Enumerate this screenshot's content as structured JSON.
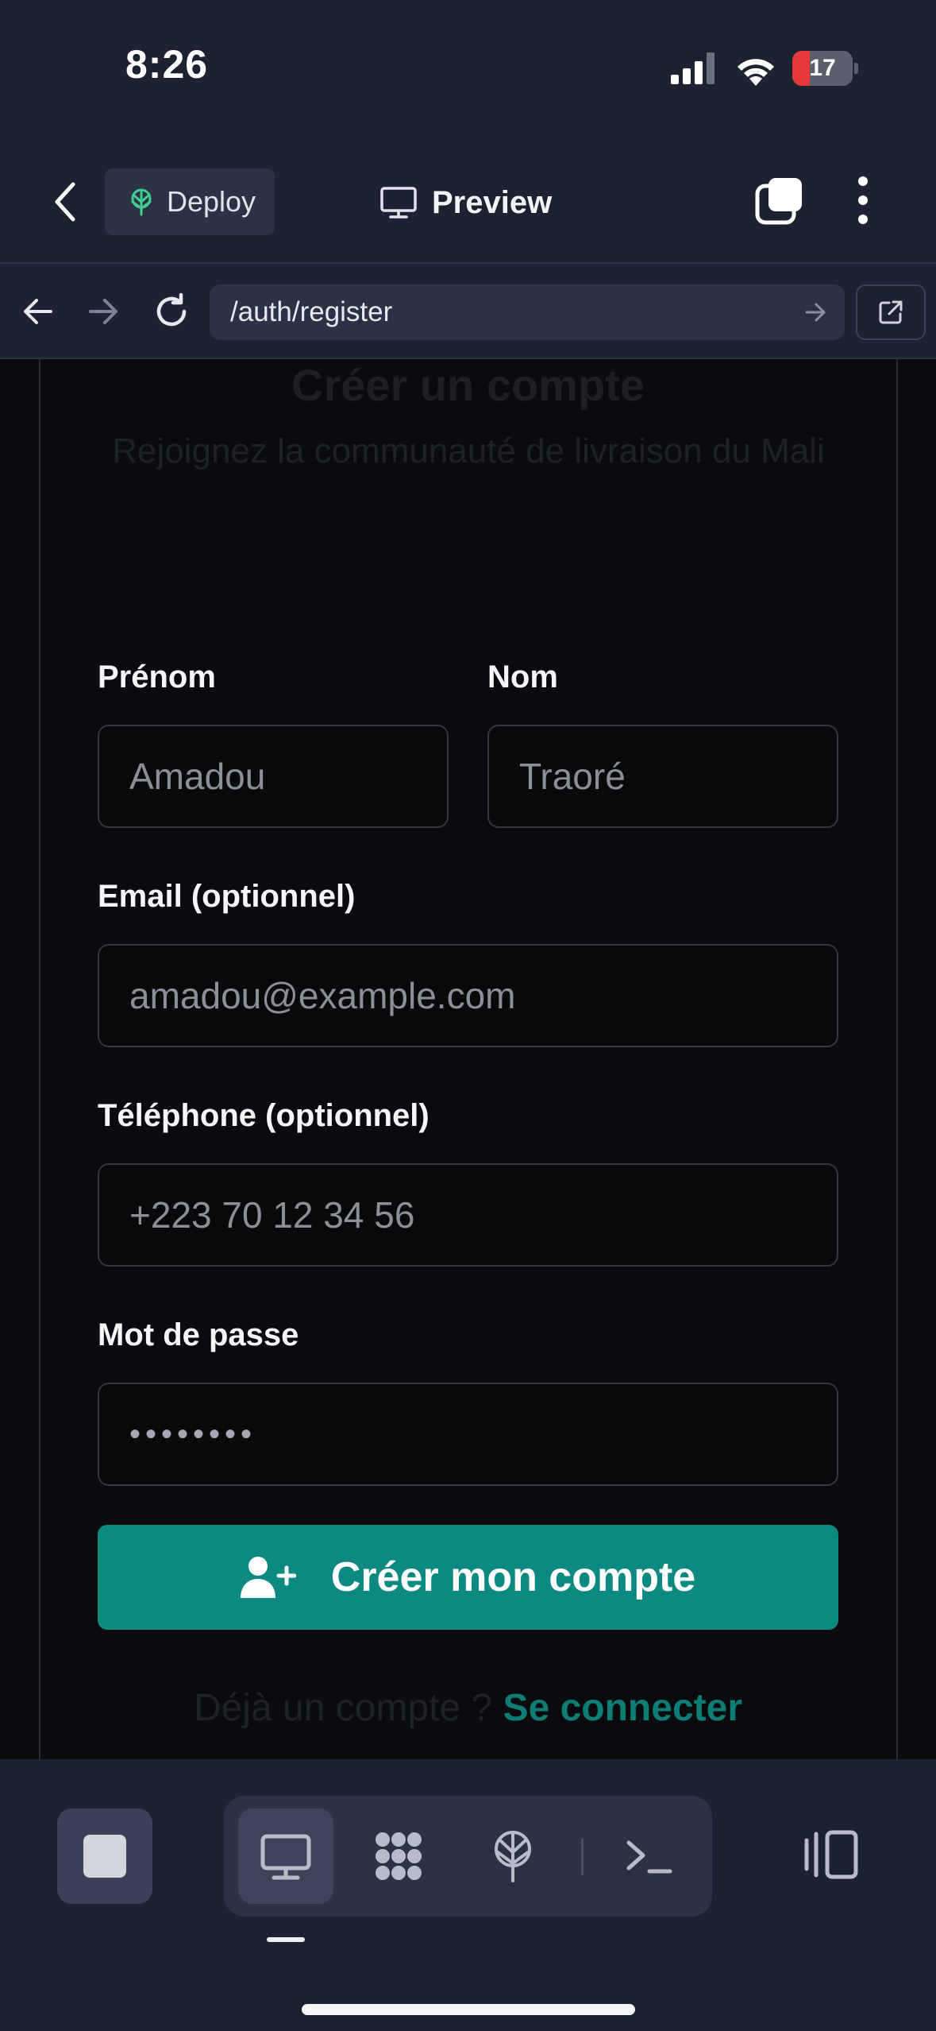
{
  "status_bar": {
    "time": "8:26",
    "battery": "17"
  },
  "toolbar": {
    "deploy_label": "Deploy",
    "preview_label": "Preview"
  },
  "urlbar": {
    "url": "/auth/register"
  },
  "page": {
    "title": "Créer un compte",
    "subtitle": "Rejoignez la communauté de livraison du Mali",
    "fields": {
      "first_name": {
        "label": "Prénom",
        "placeholder": "Amadou"
      },
      "last_name": {
        "label": "Nom",
        "placeholder": "Traoré"
      },
      "email": {
        "label": "Email (optionnel)",
        "placeholder": "amadou@example.com"
      },
      "phone": {
        "label": "Téléphone (optionnel)",
        "placeholder": "+223 70 12 34 56"
      },
      "password": {
        "label": "Mot de passe",
        "value": "••••••••"
      }
    },
    "submit_label": "Créer mon compte",
    "login_prefix": "Déjà un compte ?",
    "login_link": "Se connecter"
  },
  "colors": {
    "chrome_bg": "#1c2232",
    "page_bg": "#0a0b0e",
    "accent": "#0c8a82",
    "battery_low": "#e5383b"
  },
  "icons": {
    "deploy": "deploy-tree-icon",
    "preview": "monitor-icon",
    "submit": "user-plus-icon",
    "bottom_nav": [
      "stop-icon",
      "monitor-icon",
      "grid-apps-icon",
      "deploy-tree-icon",
      "terminal-icon",
      "device-toggle-icon"
    ]
  }
}
